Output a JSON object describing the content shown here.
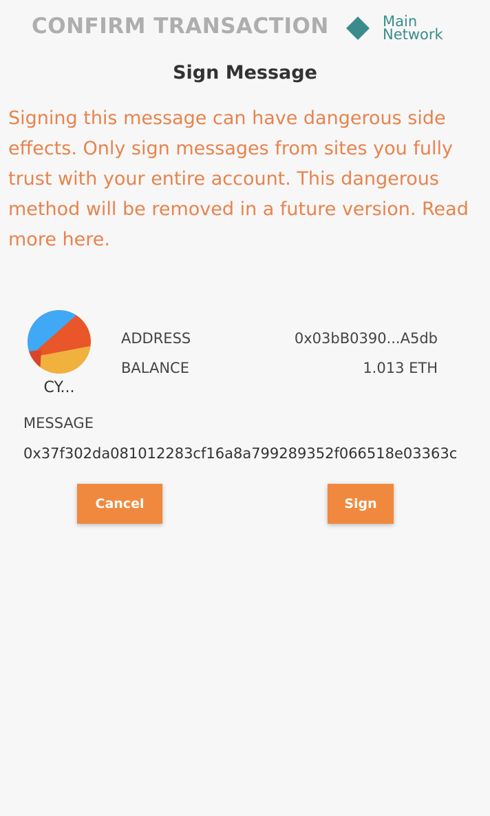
{
  "header": {
    "title": "CONFIRM TRANSACTION",
    "network_label": "Main Network"
  },
  "title": "Sign Message",
  "warning": "Signing this message can have dangerous side effects. Only sign messages from sites you fully trust with your entire account. This dangerous method will be removed in a future version. Read more here.",
  "account": {
    "name": "CY...",
    "address_label": "ADDRESS",
    "address_value": "0x03bB0390...A5db",
    "balance_label": "BALANCE",
    "balance_value": "1.013 ETH"
  },
  "message": {
    "label": "MESSAGE",
    "value": "0x37f302da081012283cf16a8a799289352f066518e03363c"
  },
  "buttons": {
    "cancel": "Cancel",
    "sign": "Sign"
  },
  "colors": {
    "network": "#3a8c8c",
    "warning": "#e8834d",
    "button": "#f0893d"
  }
}
